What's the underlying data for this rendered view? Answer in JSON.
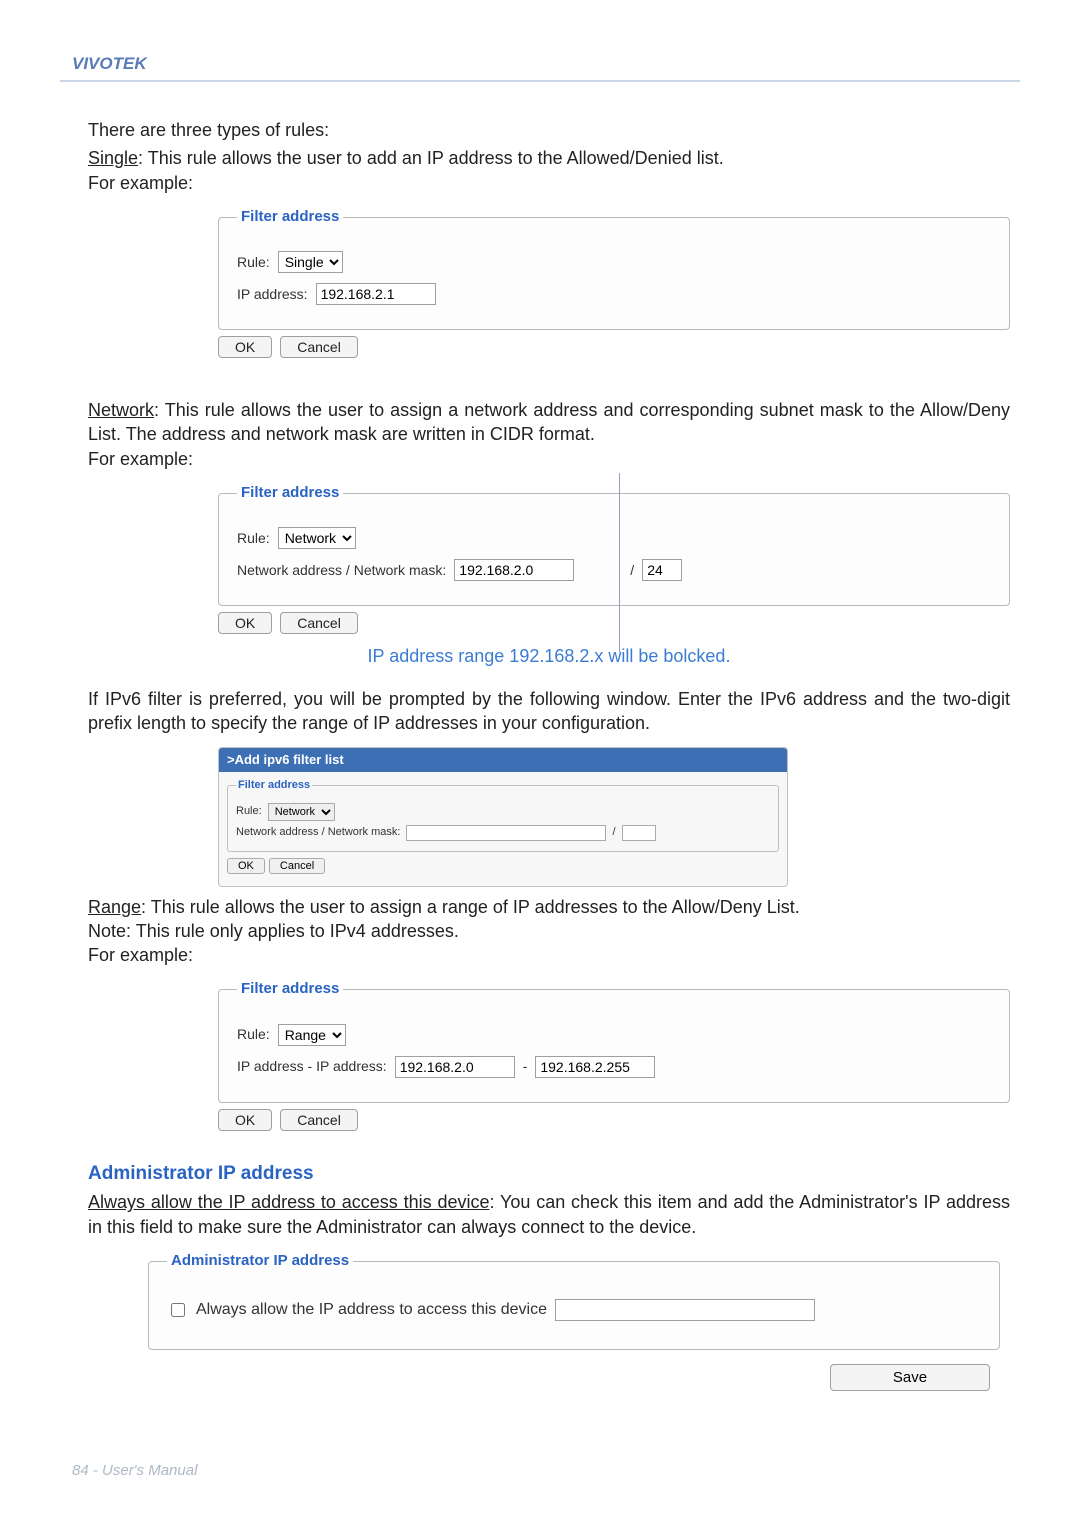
{
  "header": {
    "brand": "VIVOTEK"
  },
  "intro": {
    "types_intro": "There are three types of rules:",
    "single_label": "Single",
    "single_desc": ": This rule allows the user to add an IP address to the Allowed/Denied list.",
    "for_example": "For example:"
  },
  "fieldset_legend": "Filter address",
  "labels": {
    "rule": "Rule:",
    "ip_address": "IP address:",
    "net_addr_mask": "Network address / Network mask:",
    "ip_range": "IP address - IP address:",
    "slash": "/",
    "dash": "-",
    "ok": "OK",
    "cancel": "Cancel",
    "save": "Save"
  },
  "example1": {
    "rule_value": "Single",
    "ip_value": "192.168.2.1"
  },
  "network_rule": {
    "heading": "Network",
    "desc": ": This rule allows the user to assign a network address and corresponding subnet mask to the Allow/Deny List. The address and network mask are written in CIDR format."
  },
  "example2": {
    "rule_value": "Network",
    "addr_value": "192.168.2.0",
    "mask_value": "24"
  },
  "callout": "IP address range 192.168.2.x will be bolcked.",
  "ipv6": {
    "intro": "If IPv6 filter is preferred, you will be prompted by the following window. Enter the IPv6 address and the two-digit prefix length to specify the range of IP addresses in your configuration.",
    "popup_title": ">Add ipv6 filter list",
    "rule_value": "Network",
    "addr_value": "",
    "mask_value": ""
  },
  "range_rule": {
    "heading": "Range",
    "desc": ": This rule allows the user to assign a range of IP addresses to the Allow/Deny List.",
    "note": "Note: This rule only applies to IPv4 addresses."
  },
  "example3": {
    "rule_value": "Range",
    "from_value": "192.168.2.0",
    "to_value": "192.168.2.255"
  },
  "admin": {
    "heading": "Administrator IP address",
    "strong": "Always allow the IP address to access this device",
    "desc": ": You can check this item and add the Administrator's IP address in this field to make sure the Administrator can always connect to the device.",
    "legend": "Administrator IP address",
    "checkbox_label": "Always allow the IP address to access this device",
    "ip_value": ""
  },
  "footer": "84 - User's Manual"
}
